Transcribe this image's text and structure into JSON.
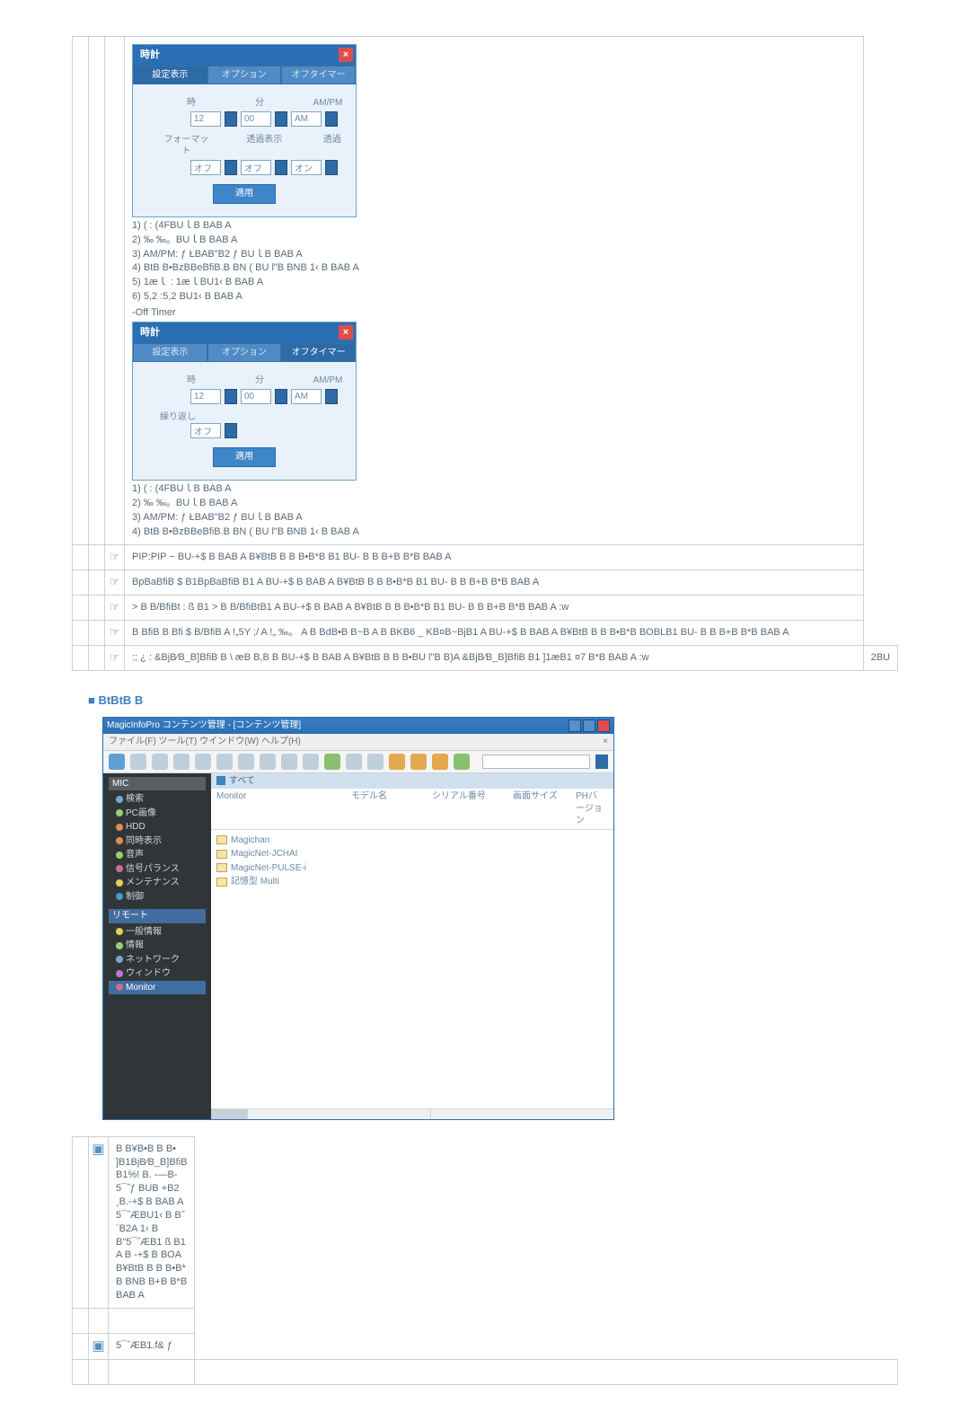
{
  "clock_dialog": {
    "titlebar": "時計",
    "tabs": [
      "設定表示",
      "オプション",
      "オフタイマー"
    ],
    "col_headers": [
      "時",
      "分",
      "AM/PM"
    ],
    "row1": {
      "label": "",
      "h": "12",
      "m": "00",
      "ampm": "AM"
    },
    "format_row": {
      "label_l": "フォーマット",
      "label_r": "透過表示",
      "v1": "オフ",
      "v2": "オフ",
      "v3": "オン"
    },
    "apply_btn": "適用",
    "notes": [
      "1)  ( : (4FBUｌB BAB A",
      "2)  ‰ ‰。BUｌB BAB A",
      "3) AM/PM: ƒ ŁBAB\"B2 ƒ  BUｌB BAB A",
      "4) BtB B•BzBBeBfiB.B BN (  BU  l\"B BNB 1‹ B BAB A",
      "5)  1æｌ   : 1æｌBU1‹ B BAB A",
      "6) 5,2  :5,2 BU1‹ B BAB A"
    ]
  },
  "off_timer": {
    "header": "-Off Timer",
    "titlebar": "時計",
    "tabs": [
      "設定表示",
      "オプション",
      "オフタイマー"
    ],
    "col_headers": [
      "時",
      "分",
      "AM/PM"
    ],
    "row1": {
      "h": "12",
      "m": "00",
      "ampm": "AM"
    },
    "repeat_row": {
      "label": "繰り返し",
      "v": "オフ"
    },
    "apply_btn": "適用",
    "notes": [
      "1)  ( : (4FBUｌB BAB A",
      "2)  ‰ ‰。BUｌB BAB A",
      "3) AM/PM: ƒ ŁBAB\"B2 ƒ  BUｌB BAB A",
      "4) BtB B•BzBBeBfiB.B BN (  BU  l\"B BNB 1‹ B BAB A"
    ]
  },
  "rows": [
    "PIP:PIP −  BU-+$ B BAB A B¥BtB B B B•B*B B1    BU- B B B+B B*B BAB A",
    "BpBaBfiB $    B1BpBaBfiB B1 A  BU-+$ B BAB A B¥BtB B B B•B*B B1    BU- B B B+B B*B BAB A",
    ">  B B/BfiBt : ß  B1 >  B B/BfiBtB1 A  BU-+$ B BAB A B¥BtB B B B•B*B B1    BU- B B B+B B*B BAB A :w",
    "B BfiB B Bfi $ B/BfiB     A !„5Y ;/ A !„  ‰。 A B BdB•B B~B A B BKB6 _ KB¤B~BjB1 A  BU-+$ B BAB A B¥BtB B B B•B*B BOBLB1    BU- B B B+B B*B BAB A"
  ],
  "row5_main": ":; ¿  : &BjB⁄B_B]BfiB B  \\ æB B,B B BU-+$ B BAB A B¥BtB B B B•BU  l\"B B)A  &BjB⁄B_B]BfiB B1 ]1æB1 ¤7 B*B BAB A :w",
  "row5_right": "2BU",
  "section_title": "BtBtB B",
  "app": {
    "title": "MagicInfoPro コンテンツ管理 - [コンテンツ管理]",
    "menu": "ファイル(F)  ツール(T)  ウインドウ(W)  ヘルプ(H)",
    "menu_right": "×",
    "path_label": "すべて",
    "columns": [
      "Monitor",
      "モデル名",
      "シリアル番号",
      "画面サイズ",
      "PHバージョン"
    ],
    "tree_root": "MIC",
    "tree_a": [
      "検索",
      "PC画像",
      "HDD",
      "同時表示",
      "音声",
      "信号パランス",
      "メンテナンス",
      "制御"
    ],
    "tree_sel": "リモート",
    "tree_b": [
      "一般情報",
      "情報",
      "ネットワーク",
      "ウィンドウ",
      "Monitor"
    ],
    "items": [
      "Magichan",
      "MagicNet-JCHAI",
      "MagicNet-PULSE-i",
      "記憶型 Multi"
    ]
  },
  "bottom_rows": [
    "B B¥B•B B B•  ]B1BjB⁄B_B]BfiB B1%! B.  -—B-5¯˝ƒ BUB +B2 ¸B.-+$ B BAB A 5¯˝ÆBU1‹ B B˝   ´B2A 1‹ B B\"5¯˝ÆB1 ß  B1 A  B -+$ B BOA B¥BtB B B B•B*    B BNB B+B B*B BAB A"
  ],
  "pointer_row": "5¯˝ÆB1.f& ƒ"
}
